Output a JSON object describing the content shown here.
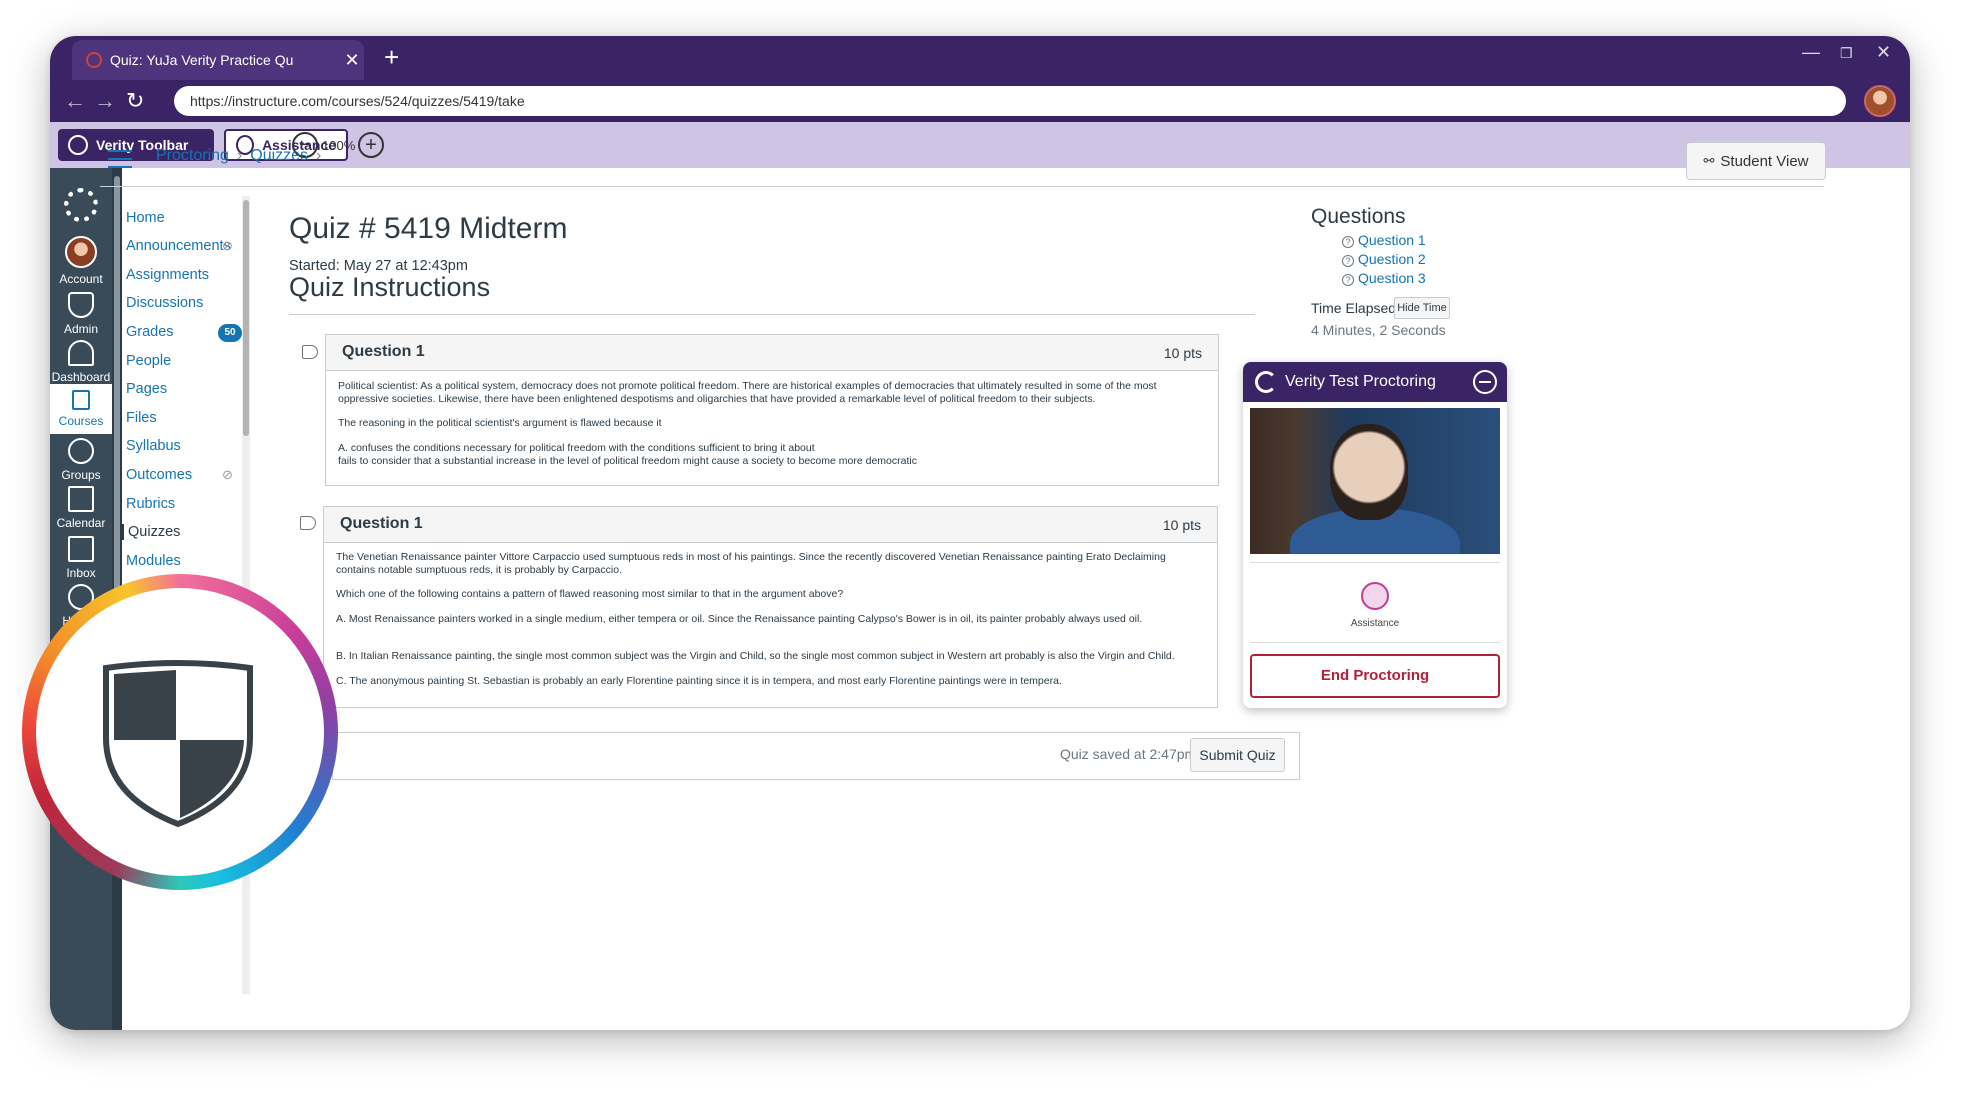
{
  "browser": {
    "tab_title": "Quiz: YuJa Verity Practice Qu",
    "new_tab": "+",
    "url": "https://instructure.com/courses/524/quizzes/5419/take",
    "window_controls": [
      "—",
      "❐",
      "✕"
    ]
  },
  "verity_toolbar": {
    "toolbar_label": "Verity Toolbar",
    "assistance_label": "Assistance",
    "zoom_out": "−",
    "zoom_level": "100%",
    "zoom_in": "+"
  },
  "global_nav": {
    "items": [
      {
        "label": "Account",
        "icon": "account-avatar"
      },
      {
        "label": "Admin",
        "icon": "shield-icon"
      },
      {
        "label": "Dashboard",
        "icon": "dashboard-icon"
      },
      {
        "label": "Courses",
        "icon": "book-icon",
        "active": true
      },
      {
        "label": "Groups",
        "icon": "groups-icon"
      },
      {
        "label": "Calendar",
        "icon": "calendar-icon"
      },
      {
        "label": "Inbox",
        "icon": "inbox-icon"
      },
      {
        "label": "History",
        "icon": "clock-icon"
      }
    ]
  },
  "breadcrumb": {
    "items": [
      "Proctoring",
      "Quizzes"
    ],
    "separator": "›"
  },
  "student_view": {
    "icon": "glasses-icon",
    "label": "Student View"
  },
  "course_nav": {
    "items": [
      {
        "label": "Home"
      },
      {
        "label": "Announcements",
        "hidden_icon": true
      },
      {
        "label": "Assignments"
      },
      {
        "label": "Discussions"
      },
      {
        "label": "Grades",
        "badge": "50"
      },
      {
        "label": "People"
      },
      {
        "label": "Pages"
      },
      {
        "label": "Files"
      },
      {
        "label": "Syllabus"
      },
      {
        "label": "Outcomes",
        "hidden_icon": true
      },
      {
        "label": "Rubrics"
      },
      {
        "label": "Quizzes",
        "active": true
      },
      {
        "label": "Modules"
      }
    ]
  },
  "quiz": {
    "title": "Quiz # 5419 Midterm",
    "started": "Started: May 27 at 12:43pm",
    "instructions_heading": "Quiz Instructions",
    "questions": [
      {
        "name": "Question 1",
        "points": "10 pts",
        "paragraphs": [
          "Political scientist: As a political system, democracy does not promote political freedom. There are historical examples of democracies that ultimately resulted in some of the most oppressive societies. Likewise, there have been enlightened despotisms and oligarchies that have provided a remarkable level of political freedom to their subjects.",
          "The reasoning in the political scientist's argument is flawed because it",
          "A. confuses the conditions necessary for political freedom with the conditions sufficient to bring it about",
          "fails to consider that a substantial increase in the level of political freedom might cause a society to become more democratic"
        ]
      },
      {
        "name": "Question 1",
        "points": "10 pts",
        "paragraphs": [
          "The Venetian Renaissance painter Vittore Carpaccio used sumptuous reds in most of his paintings. Since the recently discovered Venetian Renaissance painting Erato Declaiming contains notable sumptuous reds, it is probably by Carpaccio.",
          "Which one of the following contains a pattern of flawed reasoning most similar to that in the argument above?",
          "A. Most Renaissance painters worked in a single medium, either tempera or oil. Since the Renaissance painting Calypso's Bower is in oil, its painter probably always used oil.",
          "B. In Italian Renaissance painting, the single most common subject was the Virgin and Child, so the single most common subject in Western art probably is also the Virgin and Child.",
          "C. The anonymous painting St. Sebastian is probably an early Florentine painting since it is in tempera, and most early Florentine paintings were in tempera."
        ]
      }
    ],
    "saved_text": "Quiz saved at 2:47pm",
    "submit_label": "Submit Quiz"
  },
  "sidebar": {
    "title": "Questions",
    "question_links": [
      "Question 1",
      "Question 2",
      "Question 3"
    ],
    "time_elapsed_label": "Time Elapsed:",
    "hide_time_label": "Hide Time",
    "time_elapsed_value": "4 Minutes, 2 Seconds"
  },
  "verity_panel": {
    "title": "Verity Test Proctoring",
    "assistance_label": "Assistance",
    "end_label": "End Proctoring"
  },
  "colors": {
    "browser_purple": "#3b2466",
    "verity_bar": "#cfc4e3",
    "link_blue": "#1574b4",
    "global_nav": "#394b58",
    "end_red": "#b3203a"
  }
}
